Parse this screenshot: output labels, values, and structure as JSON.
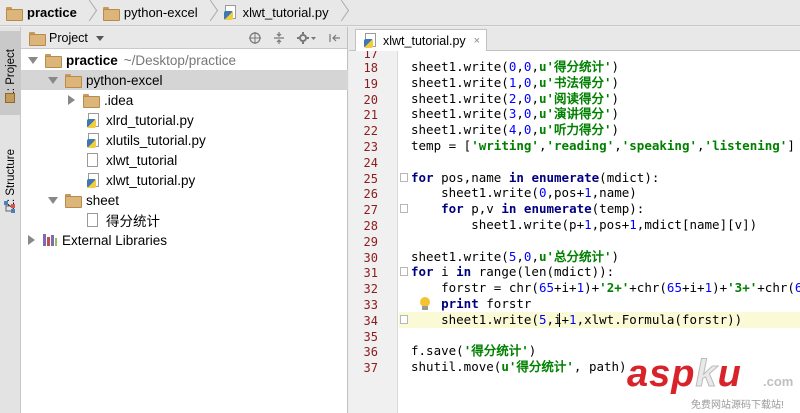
{
  "breadcrumb": {
    "items": [
      "practice",
      "python-excel",
      "xlwt_tutorial.py"
    ]
  },
  "tool_stripe": {
    "project_tab": "1: Project",
    "structure_tab": "Z: Structure"
  },
  "project_panel": {
    "title": "Project",
    "tree": [
      {
        "label": "practice",
        "path": "~/Desktop/practice"
      },
      {
        "label": "python-excel"
      },
      {
        "label": ".idea"
      },
      {
        "label": "xlrd_tutorial.py"
      },
      {
        "label": "xlutils_tutorial.py"
      },
      {
        "label": "xlwt_tutorial"
      },
      {
        "label": "xlwt_tutorial.py"
      },
      {
        "label": "sheet"
      },
      {
        "label": "得分统计"
      },
      {
        "label": "External Libraries"
      }
    ]
  },
  "editor": {
    "tab_label": "xlwt_tutorial.py",
    "top_partial_line": "17",
    "line_numbers": [
      "18",
      "19",
      "20",
      "21",
      "22",
      "23",
      "24",
      "25",
      "26",
      "27",
      "28",
      "29",
      "30",
      "31",
      "32",
      "33",
      "34",
      "35",
      "36",
      "37"
    ]
  },
  "colors": {
    "line_number": "#8c1b1b",
    "keyword": "#000080",
    "string": "#008000",
    "number": "#0000ff",
    "current_line": "#fbfad6"
  },
  "watermark": {
    "brand": "asp",
    "brand_k": "k",
    "brand_u": "u",
    "tld": ".com",
    "slogan": "免费网站源码下载站!"
  }
}
